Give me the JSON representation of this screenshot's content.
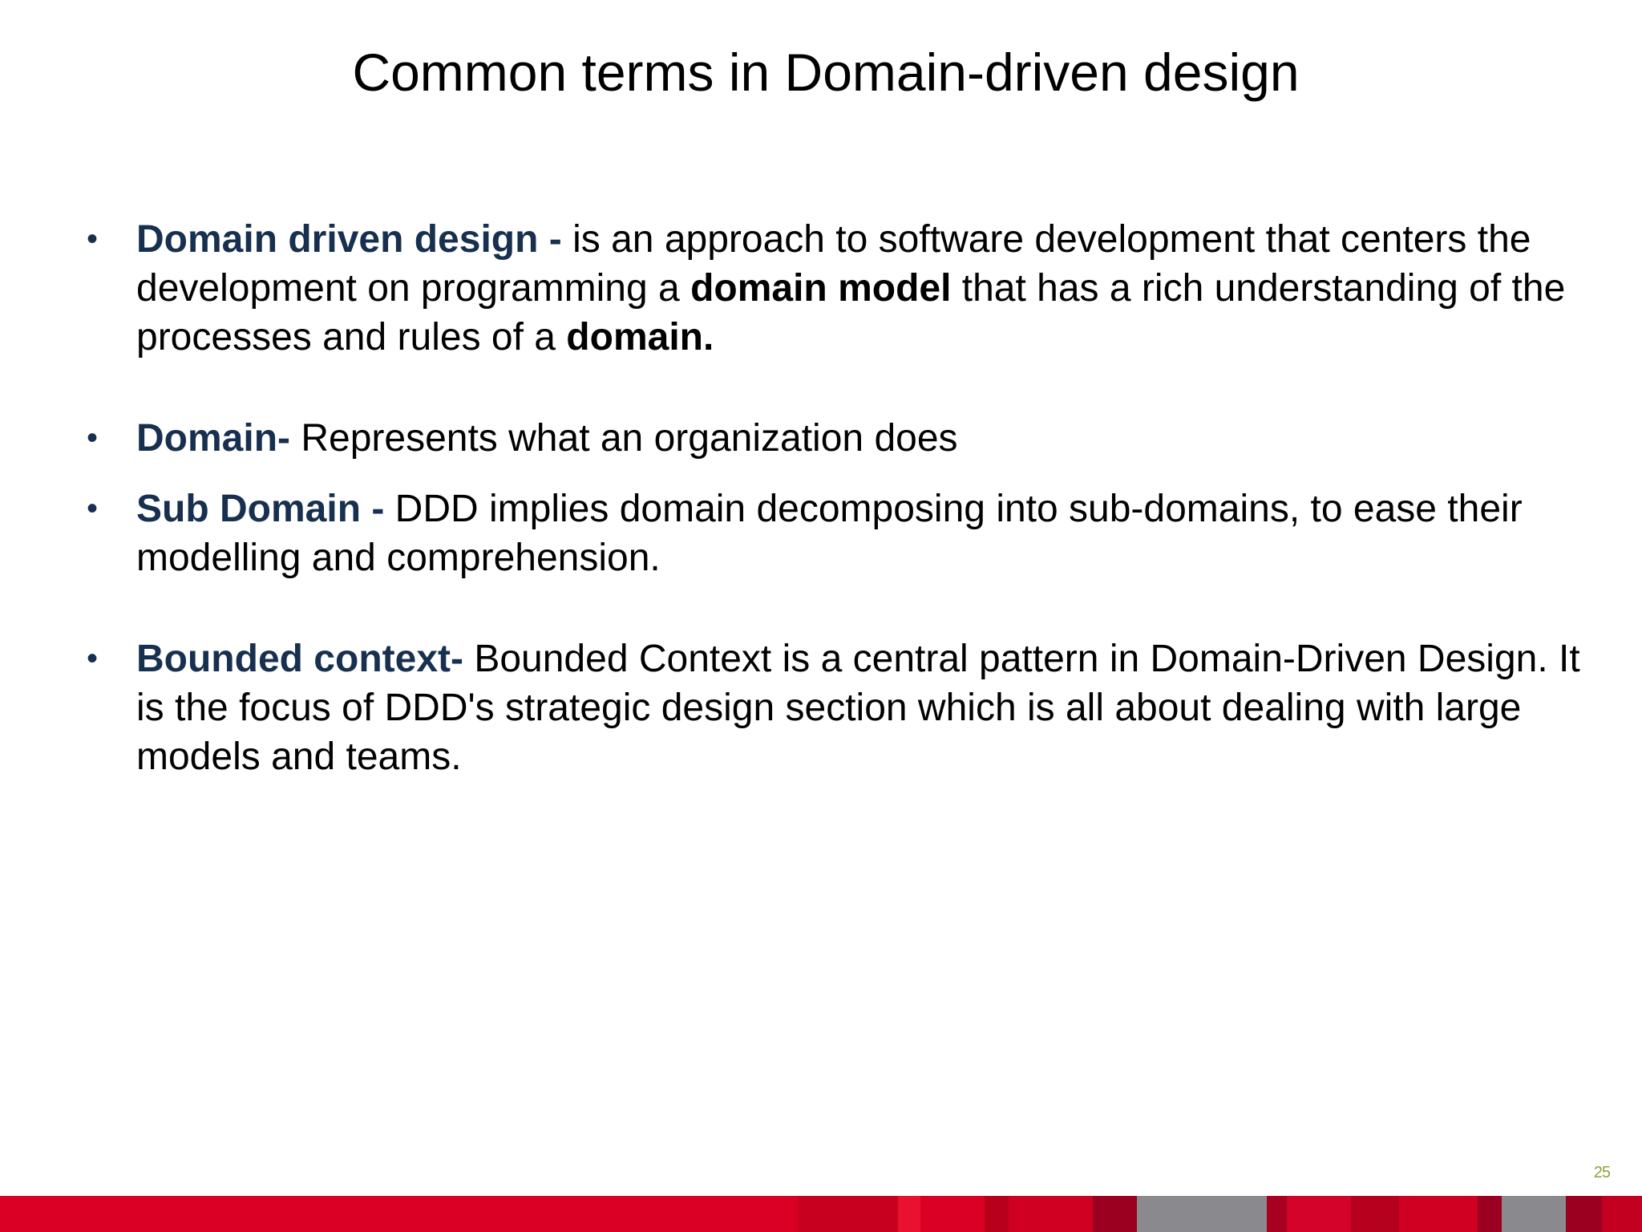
{
  "slide": {
    "title": "Common terms in Domain-driven design",
    "page_number": "25"
  },
  "bullets": [
    {
      "term": "Domain driven design -",
      "text_1": " is an approach to software development that centers the development on programming a ",
      "strong_1": "domain model",
      "text_2": " that has a rich understanding of the processes and rules of a ",
      "strong_2": "domain."
    },
    {
      "term": "Domain-",
      "text_1": " Represents what an organization does"
    },
    {
      "term": "Sub Domain -",
      "text_1": " DDD implies domain decomposing into sub-domains, to ease their modelling and comprehension."
    },
    {
      "term": "Bounded context-",
      "text_1": " Bounded Context is a central pattern in Domain-Driven Design. It is the focus of DDD's strategic design section which is all about dealing with large models and teams."
    }
  ],
  "bullet_glyph": "•",
  "colors": {
    "term": "#17304f",
    "footer_red": "#da0025",
    "footer_dark_red": "#9b0020",
    "footer_gray": "#8a8a8e",
    "page_number": "#8fa33a"
  }
}
